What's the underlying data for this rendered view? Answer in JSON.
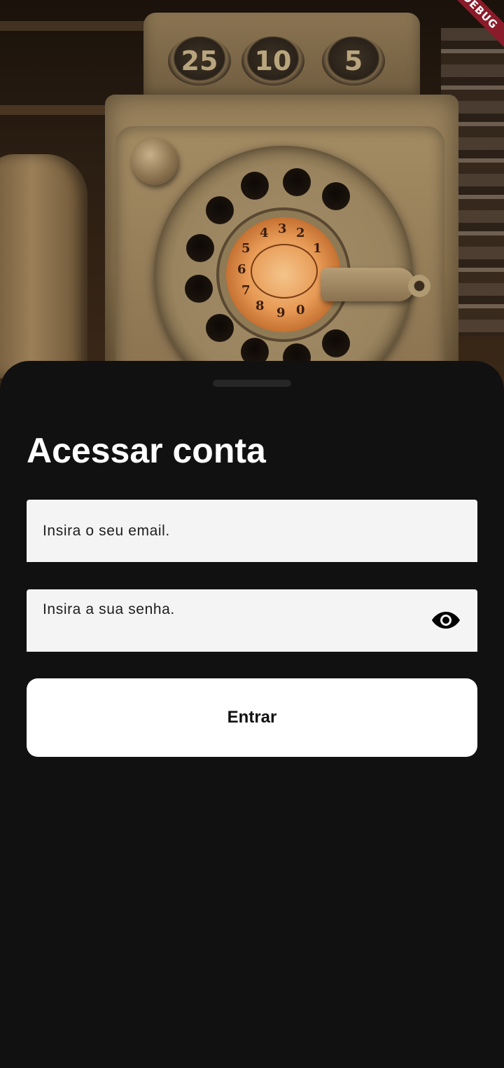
{
  "hero": {
    "image_subject": "vintage rotary payphone",
    "coin_labels": [
      "25",
      "10",
      "5"
    ],
    "dial_digits": [
      "4",
      "3",
      "2",
      "1",
      "5",
      "6",
      "7",
      "8",
      "9",
      "0"
    ]
  },
  "debug_banner": "DEBUG",
  "login": {
    "title": "Acessar conta",
    "email_placeholder": "Insira o seu email.",
    "password_placeholder": "Insira a sua senha.",
    "password_toggle_icon": "eye-icon",
    "submit_label": "Entrar"
  },
  "colors": {
    "sheet_background": "#111111",
    "field_background": "#f4f4f4",
    "button_background": "#ffffff",
    "debug_ribbon": "#8a1c2a"
  }
}
